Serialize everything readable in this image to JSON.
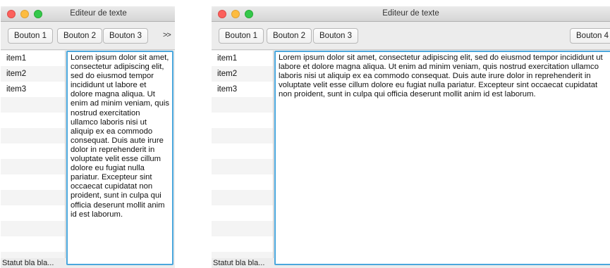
{
  "window_title": "Editeur de texte",
  "buttons": [
    "Bouton 1",
    "Bouton 2",
    "Bouton 3",
    "Bouton 4"
  ],
  "overflow_label": ">>",
  "list_items": [
    "item1",
    "item2",
    "item3"
  ],
  "text_content": "Lorem ipsum dolor sit amet, consectetur adipiscing elit, sed do eiusmod tempor incididunt ut labore et dolore magna aliqua. Ut enim ad minim veniam, quis nostrud exercitation ullamco laboris nisi ut aliquip ex ea commodo consequat. Duis aute irure dolor in reprehenderit in voluptate velit esse cillum dolore eu fugiat nulla pariatur. Excepteur sint occaecat cupidatat non proident, sunt in culpa qui officia deserunt mollit anim id est laborum.",
  "status_text": "Statut bla bla...",
  "colors": {
    "focus_border": "#4aa7dd",
    "close": "#fc605c",
    "minimize": "#fdbc40",
    "maximize": "#34c84a"
  }
}
